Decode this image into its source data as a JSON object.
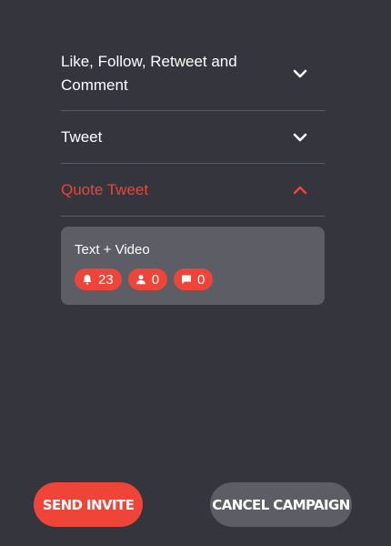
{
  "accordion": {
    "items": [
      {
        "label": "Like, Follow, Retweet and Comment",
        "expanded": false
      },
      {
        "label": "Tweet",
        "expanded": false
      },
      {
        "label": "Quote Tweet",
        "expanded": true
      }
    ]
  },
  "panel": {
    "title": "Text + Video",
    "badges": [
      {
        "icon": "bell-icon",
        "value": "23"
      },
      {
        "icon": "user-icon",
        "value": "0"
      },
      {
        "icon": "comment-icon",
        "value": "0"
      }
    ]
  },
  "actions": {
    "send_label": "SEND INVITE",
    "cancel_label": "CANCEL CAMPAIGN"
  },
  "colors": {
    "background": "#34353d",
    "accent": "#ef4438",
    "panel": "#5c5d65"
  }
}
